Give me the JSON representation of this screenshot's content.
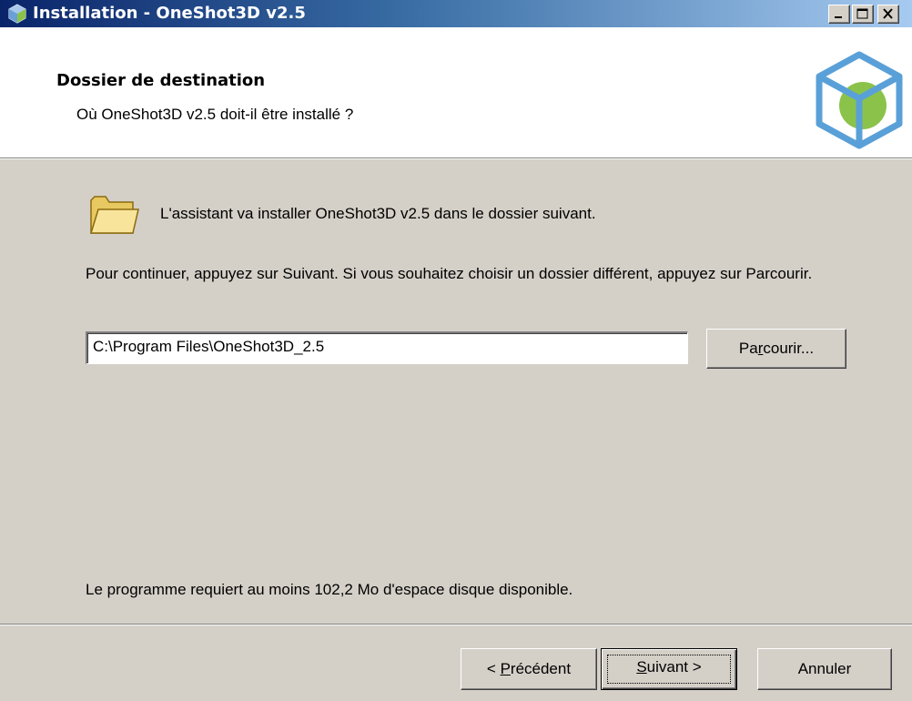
{
  "window": {
    "title": "Installation - OneShot3D v2.5",
    "controls": [
      "minimize",
      "maximize",
      "close"
    ]
  },
  "header": {
    "title": "Dossier de destination",
    "subtitle": "Où OneShot3D v2.5 doit-il être installé ?"
  },
  "body": {
    "intro": "L'assistant va installer OneShot3D v2.5 dans le dossier suivant.",
    "description": "Pour continuer, appuyez sur Suivant. Si vous souhaitez choisir un dossier différent, appuyez sur Parcourir.",
    "path_value": "C:\\Program Files\\OneShot3D_2.5",
    "browse": {
      "pre": "Pa",
      "key": "r",
      "post": "courir..."
    },
    "space_required": "Le programme requiert au moins 102,2 Mo d'espace disque disponible."
  },
  "footer": {
    "back": {
      "pre": "< ",
      "key": "P",
      "post": "récédent"
    },
    "next": {
      "pre": "",
      "key": "S",
      "post": "uivant >"
    },
    "cancel": "Annuler"
  },
  "colors": {
    "dialog_bg": "#d4d0c8",
    "titlebar_start": "#0a246a",
    "titlebar_end": "#a6caf0",
    "logo_blue": "#5aa0d8",
    "logo_green": "#8bc34a"
  },
  "icons": {
    "title": "installer-cube-icon",
    "header_logo": "cube-logo-icon",
    "folder": "folder-icon"
  }
}
